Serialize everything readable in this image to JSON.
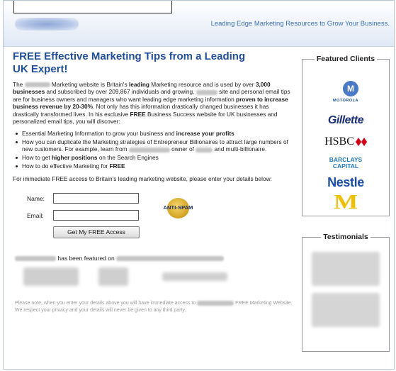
{
  "header": {
    "tagline": "Leading Edge Marketing Resources to Grow Your Business."
  },
  "main": {
    "headline": "FREE Effective Marketing Tips from a Leading UK Expert!",
    "intro": {
      "t1": "The ",
      "t2": " Marketing website is Britain's ",
      "t2b": "leading",
      "t3": " Marketing resource and is used by over ",
      "t3b": "3,000 businesses",
      "t4": " and subscribed by over 209,867 individuals and growing. ",
      "t5": " site and personal email tips are for business owners and managers who want leading edge marketing information ",
      "t5b": "proven to increase business revenue by 20-30%",
      "t6": ". Not only has this information drastically changed businesses it has drastically transformed lives. In his exclusive ",
      "t6b": "FREE",
      "t7": " Business Success website for UK businesses and personalized email tips, you will discover:"
    },
    "bullets": {
      "b1a": "Essential Marketing Information to grow your business and ",
      "b1b": "increase your profits",
      "b2a": "How you can duplicate the Marketing strategies of Entrepreneur Billionaires to attract large numbers of new customers. For example, learn from ",
      "b2b": " owner of ",
      "b2c": " and multi-billionaire.",
      "b3a": "How to get ",
      "b3b": "higher positions",
      "b3c": " on the Search Engines",
      "b4a": "How to do effective Marketing for ",
      "b4b": "FREE"
    },
    "access_text": "For immediate FREE access to Britain's leading marketing website, please enter your details below:",
    "form": {
      "name_label": "Name:",
      "email_label": "Email:",
      "name_value": "",
      "email_value": "",
      "submit_label": "Get My FREE Access",
      "badge_text": "ANTI-SPAM"
    },
    "featured_on": "has been featured on",
    "note_a": "Please note, when you enter your details above you will have immediate access to ",
    "note_b": " FREE Marketing Website. We respect your privacy and your details will never be given to any third party."
  },
  "sidebar": {
    "featured_title": "Featured Clients",
    "clients": {
      "motorola": "MOTOROLA",
      "gillette": "Gillette",
      "hsbc": "HSBC",
      "barclays_1": "BARCLAYS",
      "barclays_2": "CAPITAL",
      "nestle": "Nestle",
      "mcdonalds": "M"
    },
    "testimonials_title": "Testimonials"
  }
}
